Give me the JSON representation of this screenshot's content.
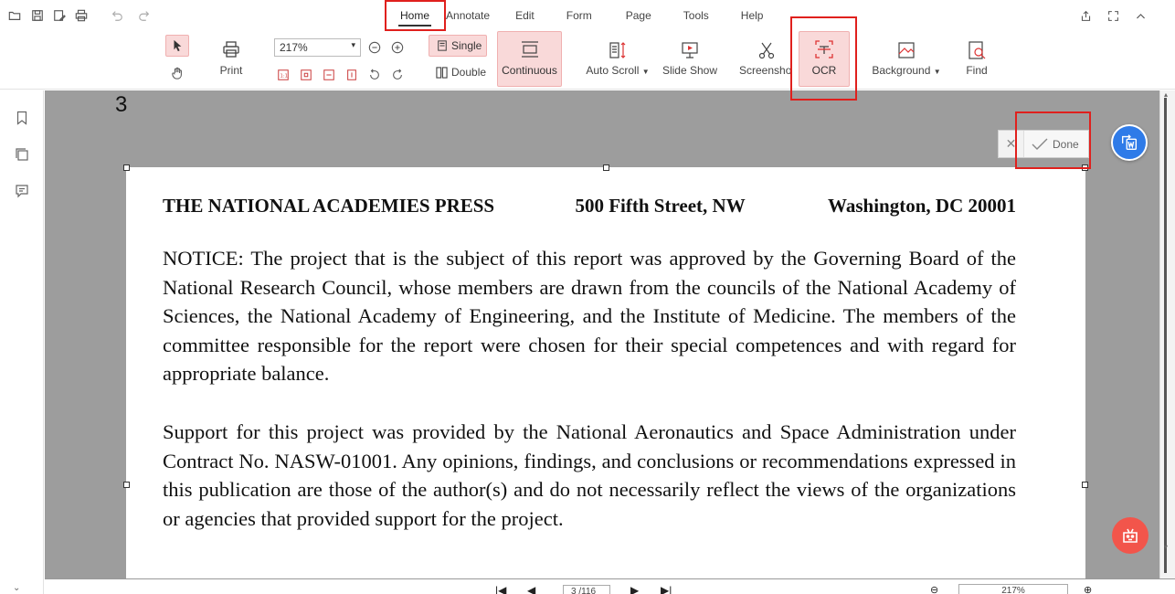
{
  "menubar": {
    "tabs": [
      {
        "label": "Home"
      },
      {
        "label": "Annotate"
      },
      {
        "label": "Edit"
      },
      {
        "label": "Form"
      },
      {
        "label": "Page"
      },
      {
        "label": "Tools"
      },
      {
        "label": "Help"
      }
    ],
    "active_tab": "Home"
  },
  "ribbon": {
    "print_label": "Print",
    "zoom_value": "217%",
    "single_label": "Single",
    "double_label": "Double",
    "continuous_label": "Continuous",
    "auto_scroll_label": "Auto Scroll",
    "slide_show_label": "Slide Show",
    "screenshot_label": "Screensho",
    "ocr_label": "OCR",
    "background_label": "Background",
    "find_label": "Find"
  },
  "viewer": {
    "page_label": "3",
    "done_label": "Done",
    "document": {
      "header": [
        "THE NATIONAL ACADEMIES PRESS",
        "500 Fifth Street, NW",
        "Washington, DC 20001"
      ],
      "notice": "NOTICE: The project that is the subject of this report was approved by the Governing Board of the National Research Council, whose members are drawn from the councils of the National Academy of Sciences, the National Academy of Engineering, and the Institute of Medicine. The members of the committee responsible for the report were chosen for their special competences and with regard for appropriate balance.",
      "support": "Support for this project was provided by the National Aeronautics and Space Administration under Contract No. NASW-01001. Any opinions, findings, and conclusions or recommendations expressed in this publication are those of the author(s) and do not necessarily reflect the views of the organizations or agencies that provided support for the project."
    }
  },
  "bottombar": {
    "page_indicator": "3 /116",
    "zoom_value": "217%"
  },
  "colors": {
    "highlight": "#e0201d",
    "viewer_bg": "#9d9d9d",
    "word_button": "#2f7be8",
    "ai_button": "#f2554b"
  }
}
